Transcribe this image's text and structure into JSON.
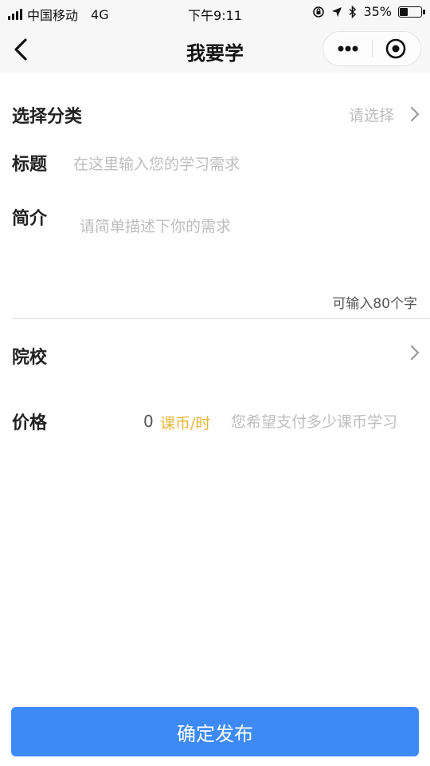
{
  "status_bar": {
    "carrier": "中国移动",
    "network": "4G",
    "time": "下午9:11",
    "battery_percent": "35%",
    "battery_level": 0.35
  },
  "nav": {
    "title": "我要学",
    "back_icon": "chevron-left-icon",
    "more_icon": "more-dots-icon",
    "close_icon": "target-circle-icon"
  },
  "form": {
    "category": {
      "label": "选择分类",
      "value": "请选择"
    },
    "title": {
      "label": "标题",
      "placeholder": "在这里输入您的学习需求"
    },
    "intro": {
      "label": "简介",
      "placeholder": "请简单描述下你的需求",
      "counter": "可输入80个字"
    },
    "school": {
      "label": "院校"
    },
    "price": {
      "label": "价格",
      "value": "0",
      "unit": "课币/时",
      "placeholder": "您希望支付多少课币学习"
    }
  },
  "submit": {
    "label": "确定发布"
  },
  "colors": {
    "accent": "#3d8af7",
    "price_unit": "#e8b43a",
    "placeholder": "#bdbdbd"
  }
}
